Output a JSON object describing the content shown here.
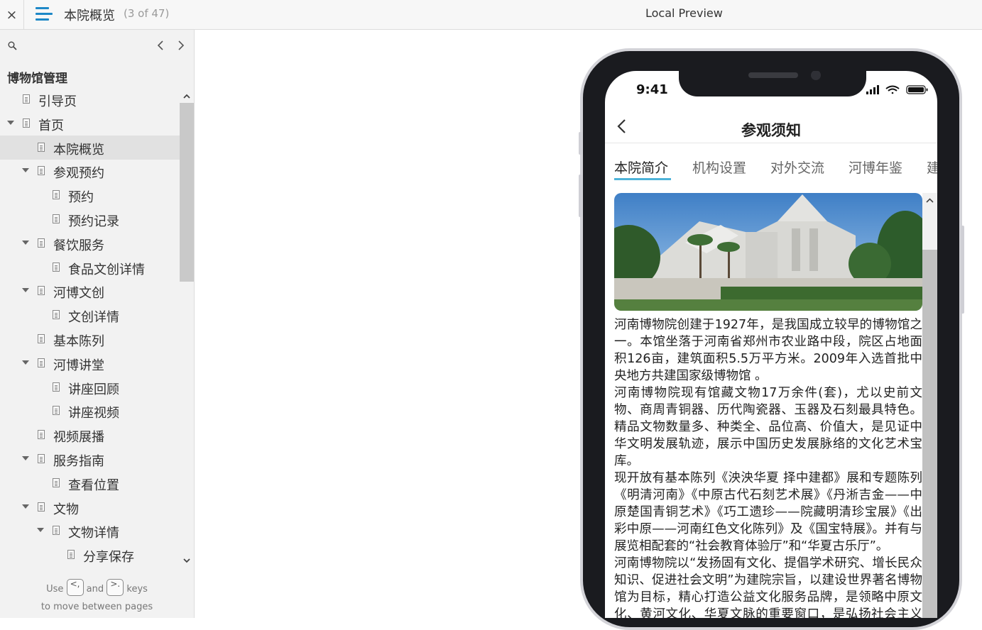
{
  "topbar": {
    "close_label": "×",
    "page_title": "本院概览",
    "page_count": "(3 of 47)",
    "preview_title": "Local Preview"
  },
  "sidebar": {
    "project_title": "博物馆管理",
    "items": [
      {
        "label": "引导页",
        "level": 0,
        "expanded": null,
        "selected": false
      },
      {
        "label": "首页",
        "level": 0,
        "expanded": true,
        "selected": false
      },
      {
        "label": "本院概览",
        "level": 1,
        "expanded": null,
        "selected": true
      },
      {
        "label": "参观预约",
        "level": 1,
        "expanded": true,
        "selected": false
      },
      {
        "label": "预约",
        "level": 2,
        "expanded": null,
        "selected": false
      },
      {
        "label": "预约记录",
        "level": 2,
        "expanded": null,
        "selected": false
      },
      {
        "label": "餐饮服务",
        "level": 1,
        "expanded": true,
        "selected": false
      },
      {
        "label": "食品文创详情",
        "level": 2,
        "expanded": null,
        "selected": false
      },
      {
        "label": "河博文创",
        "level": 1,
        "expanded": true,
        "selected": false
      },
      {
        "label": "文创详情",
        "level": 2,
        "expanded": null,
        "selected": false
      },
      {
        "label": "基本陈列",
        "level": 1,
        "expanded": null,
        "selected": false
      },
      {
        "label": "河博讲堂",
        "level": 1,
        "expanded": true,
        "selected": false
      },
      {
        "label": "讲座回顾",
        "level": 2,
        "expanded": null,
        "selected": false
      },
      {
        "label": "讲座视频",
        "level": 2,
        "expanded": null,
        "selected": false
      },
      {
        "label": "视频展播",
        "level": 1,
        "expanded": null,
        "selected": false
      },
      {
        "label": "服务指南",
        "level": 1,
        "expanded": true,
        "selected": false
      },
      {
        "label": "查看位置",
        "level": 2,
        "expanded": null,
        "selected": false
      },
      {
        "label": "文物",
        "level": 1,
        "expanded": true,
        "selected": false
      },
      {
        "label": "文物详情",
        "level": 2,
        "expanded": true,
        "selected": false
      },
      {
        "label": "分享保存",
        "level": 3,
        "expanded": null,
        "selected": false
      }
    ],
    "hint": {
      "use": "Use",
      "key_prev": "<,",
      "and": "and",
      "key_next": ">.",
      "keys": "keys",
      "line2": "to move between pages"
    }
  },
  "phone": {
    "status_time": "9:41",
    "nav_title": "参观须知",
    "tabs": [
      "本院简介",
      "机构设置",
      "对外交流",
      "河博年鉴",
      "建"
    ],
    "active_tab": 0,
    "paragraphs": [
      "河南博物院创建于1927年，是我国成立较早的博物馆之一。本馆坐落于河南省郑州市农业路中段，院区占地面积126亩，建筑面积5.5万平方米。2009年入选首批中央地方共建国家级博物馆 。",
      "河南博物院现有馆藏文物17万余件(套)，尤以史前文物、商周青铜器、历代陶瓷器、玉器及石刻最具特色。精品文物数量多、种类全、品位高、价值大，是见证中华文明发展轨迹，展示中国历史发展脉络的文化艺术宝库。",
      "现开放有基本陈列《泱泱华夏 择中建都》展和专题陈列《明清河南》《中原古代石刻艺术展》《丹淅吉金——中原楚国青铜艺术》《巧工遗珍——院藏明清珍宝展》《出彩中原——河南红色文化陈列》及《国宝特展》。并有与展览相配套的“社会教育体验厅”和“华夏古乐厅”。",
      "河南博物院以“发扬固有文化、提倡学术研究、增长民众知识、促进社会文明”为建院宗旨，以建设世界著名博物馆为目标，精心打造公益文化服务品牌，是领略中原文化、黄河文化、华夏文脉的重要窗口，是弘扬社会主义核心价值观的重要阵地，是增进文化交流合作的重要平台。"
    ]
  },
  "colors": {
    "accent": "#1e88c7",
    "tab_underline": "#4db3d9",
    "selected_row": "#e1e1e1"
  }
}
